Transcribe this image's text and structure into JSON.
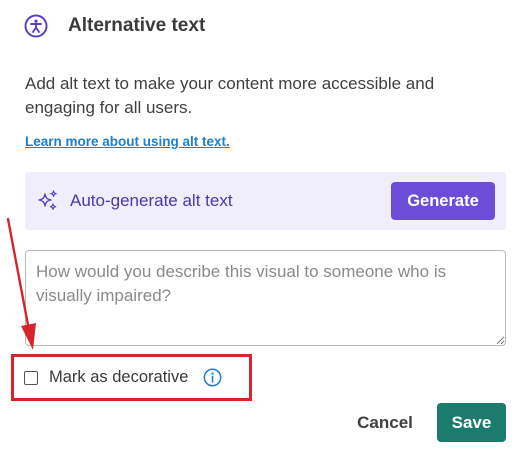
{
  "header": {
    "title": "Alternative text",
    "icon": "accessibility-icon"
  },
  "description": "Add alt text to make your content more accessible and engaging for all users.",
  "learn_link": "Learn more about using alt text.",
  "autogen": {
    "label": "Auto-generate alt text",
    "icon": "sparkle-icon",
    "button_label": "Generate"
  },
  "textarea": {
    "value": "",
    "placeholder": "How would you describe this visual to someone who is visually impaired?"
  },
  "decorative": {
    "label": "Mark as decorative",
    "checked": false,
    "icon": "info-icon"
  },
  "actions": {
    "cancel_label": "Cancel",
    "save_label": "Save"
  },
  "colors": {
    "accent_purple": "#6c4dd8",
    "panel_bg": "#f1eefc",
    "link_blue": "#1b7fd1",
    "save_teal": "#1b7b6c",
    "annotation_red": "#d7262b"
  }
}
